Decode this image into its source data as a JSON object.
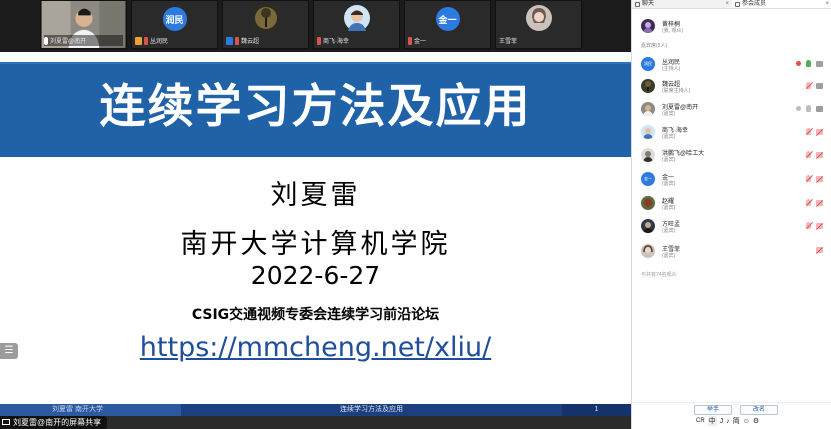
{
  "video_tiles": [
    {
      "label": "刘夏雷@南开",
      "kind": "camera",
      "mic": true
    },
    {
      "label": "丛润民",
      "avatar_text": "润民",
      "avatar_color": "#2d7be0",
      "kind": "avatar"
    },
    {
      "label": "魏云超",
      "kind": "photo-tree"
    },
    {
      "label": "商飞·海幸",
      "kind": "photo-face"
    },
    {
      "label": "金一",
      "avatar_text": "金一",
      "avatar_color": "#2d7be0",
      "kind": "avatar"
    },
    {
      "label": "王雪菲",
      "kind": "photo-girl"
    }
  ],
  "slide": {
    "title": "连续学习方法及应用",
    "author": "刘夏雷",
    "institution": "南开大学计算机学院",
    "date": "2022-6-27",
    "forum": "CSIG交通视频专委会连续学习前沿论坛",
    "url": "https://mmcheng.net/xliu/",
    "footer_left": "刘夏雷  南开大学",
    "footer_mid": "连续学习方法及应用",
    "footer_page": "1",
    "list_toggle_icon": "list-icon"
  },
  "share_label": "刘夏雷@南开的屏幕共享",
  "panel": {
    "tabs": [
      {
        "label": "聊天",
        "active": false
      },
      {
        "label": "参会成员",
        "active": true
      }
    ],
    "host": {
      "name": "黄梓桐",
      "role": "(我, 观众)"
    },
    "section_label": "嘉宾席(9人)",
    "members": [
      {
        "name": "丛润民",
        "role": "(主持人)",
        "avatar_text": "润民",
        "avatar_color": "#2d7be0",
        "mic": "red",
        "cam": "green"
      },
      {
        "name": "魏云超",
        "role": "(联席主持人)",
        "avatar_text": "",
        "avatar_color": "#3b3b2a",
        "mic": "muted",
        "cam": "green"
      },
      {
        "name": "刘夏雷@南开",
        "role": "(嘉宾)",
        "avatar_text": "",
        "avatar_color": "#6b5a4a",
        "mic": "gray",
        "cam": "green"
      },
      {
        "name": "商飞·海幸",
        "role": "(嘉宾)",
        "avatar_text": "",
        "avatar_color": "#c98b6b",
        "mic": "muted",
        "cam": "off"
      },
      {
        "name": "洪鹏飞@哈工大",
        "role": "(嘉宾)",
        "avatar_text": "",
        "avatar_color": "#7a7a7a",
        "mic": "muted",
        "cam": "off"
      },
      {
        "name": "金一",
        "role": "(嘉宾)",
        "avatar_text": "金一",
        "avatar_color": "#2d7be0",
        "mic": "muted",
        "cam": "off"
      },
      {
        "name": "赵耀",
        "role": "(嘉宾)",
        "avatar_text": "",
        "avatar_color": "#5a6b3a",
        "mic": "muted",
        "cam": "off"
      },
      {
        "name": "方旺孟",
        "role": "(嘉宾)",
        "avatar_text": "",
        "avatar_color": "#2f3b4a",
        "mic": "muted",
        "cam": "off"
      },
      {
        "name": "王雪菲",
        "role": "(嘉宾)",
        "avatar_text": "",
        "avatar_color": "#9a8f8a",
        "mic": "none",
        "cam": "off"
      }
    ],
    "total": "与共有74名观众",
    "raise_hand": "举手",
    "rename": "改名",
    "tools": [
      "CR",
      "中",
      "J",
      "♪",
      "简",
      "☺",
      "⚙"
    ]
  },
  "colors": {
    "slide_band": "#1f62a8",
    "url": "#1f4e9c",
    "accent": "#2d7be0",
    "muted_red": "#e24b4b",
    "ok_green": "#4caf50"
  }
}
